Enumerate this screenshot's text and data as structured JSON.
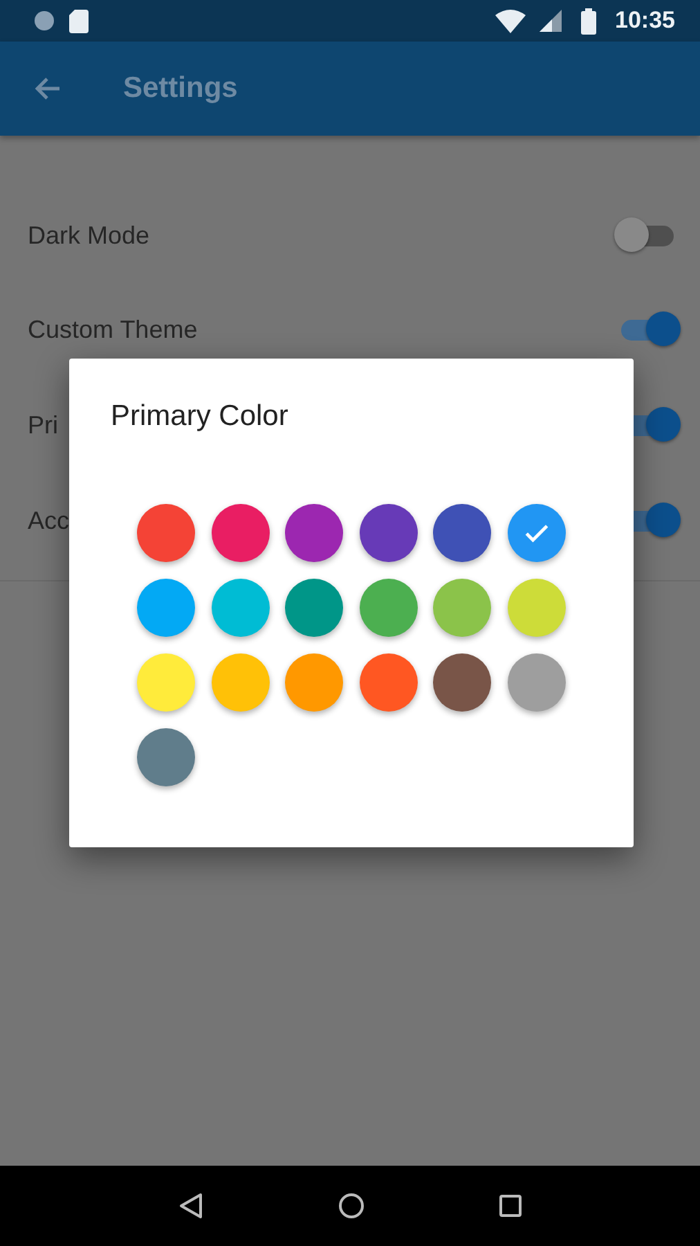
{
  "status_bar": {
    "time": "10:35"
  },
  "app_bar": {
    "title": "Settings"
  },
  "settings": [
    {
      "label": "Dark Mode",
      "kind": "switch",
      "on": false
    },
    {
      "label": "Custom Theme",
      "kind": "switch",
      "on": true
    },
    {
      "label": "Pri",
      "kind": "switch",
      "on": true
    },
    {
      "label": "Acc",
      "kind": "switch",
      "on": true
    }
  ],
  "dialog": {
    "title": "Primary Color",
    "swatches": [
      {
        "color": "#f44336",
        "selected": false
      },
      {
        "color": "#e91e63",
        "selected": false
      },
      {
        "color": "#9c27b0",
        "selected": false
      },
      {
        "color": "#673ab7",
        "selected": false
      },
      {
        "color": "#3f51b5",
        "selected": false
      },
      {
        "color": "#2196f3",
        "selected": true
      },
      {
        "color": "#03a9f4",
        "selected": false
      },
      {
        "color": "#00bcd4",
        "selected": false
      },
      {
        "color": "#009688",
        "selected": false
      },
      {
        "color": "#4caf50",
        "selected": false
      },
      {
        "color": "#8bc34a",
        "selected": false
      },
      {
        "color": "#cddc39",
        "selected": false
      },
      {
        "color": "#ffeb3b",
        "selected": false
      },
      {
        "color": "#ffc107",
        "selected": false
      },
      {
        "color": "#ff9800",
        "selected": false
      },
      {
        "color": "#ff5722",
        "selected": false
      },
      {
        "color": "#795548",
        "selected": false
      },
      {
        "color": "#9e9e9e",
        "selected": false
      },
      {
        "color": "#607d8b",
        "selected": false
      }
    ]
  }
}
